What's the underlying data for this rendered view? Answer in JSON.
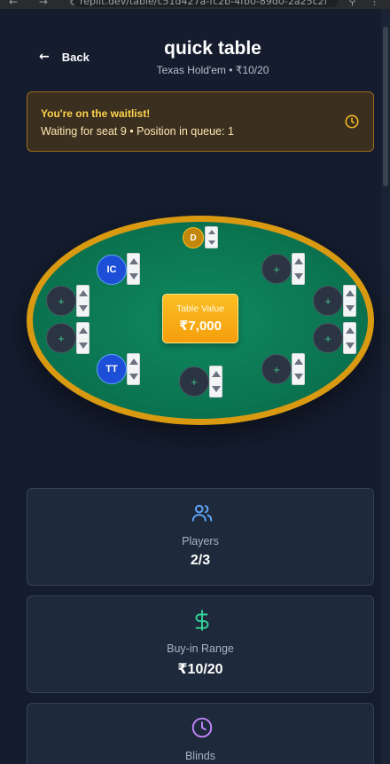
{
  "browser": {
    "nav_icons": "← → ↻",
    "url": "replit.dev/table/c51d427a-fc2b-4fb0-89d0-2a25c2f",
    "extension_icons": "⚲ ⋮"
  },
  "header": {
    "back_label": "Back",
    "title": "quick table",
    "subtitle": "Texas Hold'em • ₹10/20"
  },
  "waitlist": {
    "title": "You're on the waitlist!",
    "message": "Waiting for seat 9 • Position in queue: 1"
  },
  "table": {
    "value_label": "Table Value",
    "value_amount": "₹7,000",
    "dealer_label": "D",
    "empty_seat_symbol": "+",
    "players": [
      {
        "initials": "IC"
      },
      {
        "initials": "TT"
      }
    ]
  },
  "stats": [
    {
      "icon": "users-icon",
      "label": "Players",
      "value": "2/3",
      "color": "#60a5fa"
    },
    {
      "icon": "dollar-icon",
      "label": "Buy-in Range",
      "value": "₹10/20",
      "color": "#34d399"
    },
    {
      "icon": "clock-icon",
      "label": "Blinds",
      "value": "",
      "color": "#c084fc"
    }
  ],
  "colors": {
    "background": "#141c2e",
    "felt": "#0b7350",
    "rim": "#d99a12",
    "accent_gold": "#f59e0b",
    "player_blue": "#1d4ed8"
  }
}
